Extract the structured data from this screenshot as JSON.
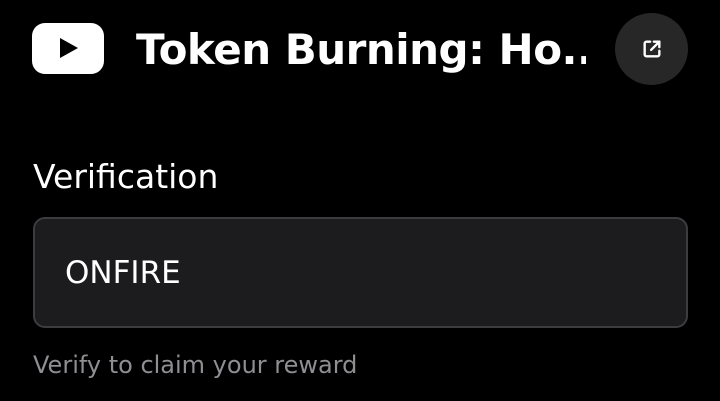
{
  "header": {
    "logo_icon": "youtube-play-icon",
    "title": "Token Burning: Ho...",
    "open_icon": "external-link-icon"
  },
  "form": {
    "label": "Verification",
    "input_value": "ONFIRE",
    "helper_text": "Verify to claim your reward"
  },
  "colors": {
    "background": "#000000",
    "text": "#ffffff",
    "input_background": "#1c1c1e",
    "input_border": "#3c3c3f",
    "button_background": "#272727",
    "helper_text": "#8e8e93"
  }
}
